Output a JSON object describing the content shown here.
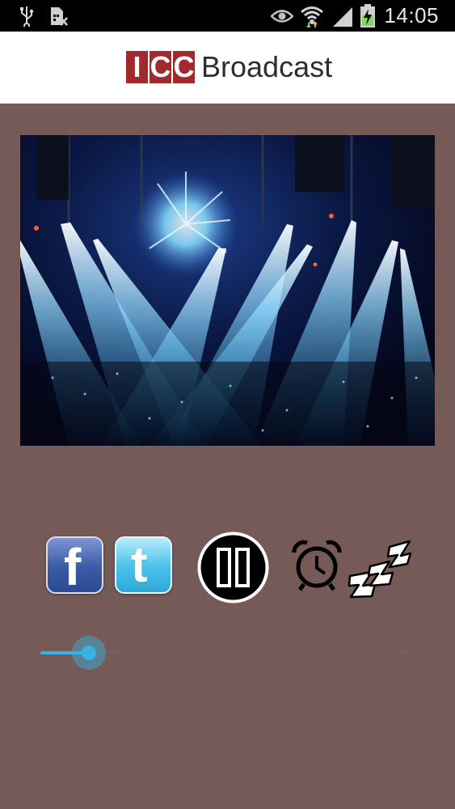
{
  "status_bar": {
    "time": "14:05",
    "icons": [
      "usb-icon",
      "sim-blocked-icon",
      "eye-icon",
      "wifi-icon",
      "signal-icon",
      "battery-charging-icon"
    ]
  },
  "header": {
    "logo_letters": [
      "I",
      "C",
      "C"
    ],
    "logo_text": "Broadcast",
    "brand_color": "#a02a2c"
  },
  "hero": {
    "image": "concert-stage-lights-photo"
  },
  "controls": {
    "facebook_icon": "facebook-icon",
    "facebook_glyph": "f",
    "twitter_icon": "twitter-icon",
    "twitter_glyph": "t",
    "play_state": "playing",
    "play_button_icon": "pause-icon",
    "alarm_icon": "alarm-clock-icon",
    "sleep_icon": "sleep-zzz-icon"
  },
  "volume": {
    "level": 0.13,
    "accent_color": "#35b4e4"
  },
  "colors": {
    "background": "#755a57",
    "header_bg": "#ffffff",
    "status_bar_bg": "#000000"
  }
}
